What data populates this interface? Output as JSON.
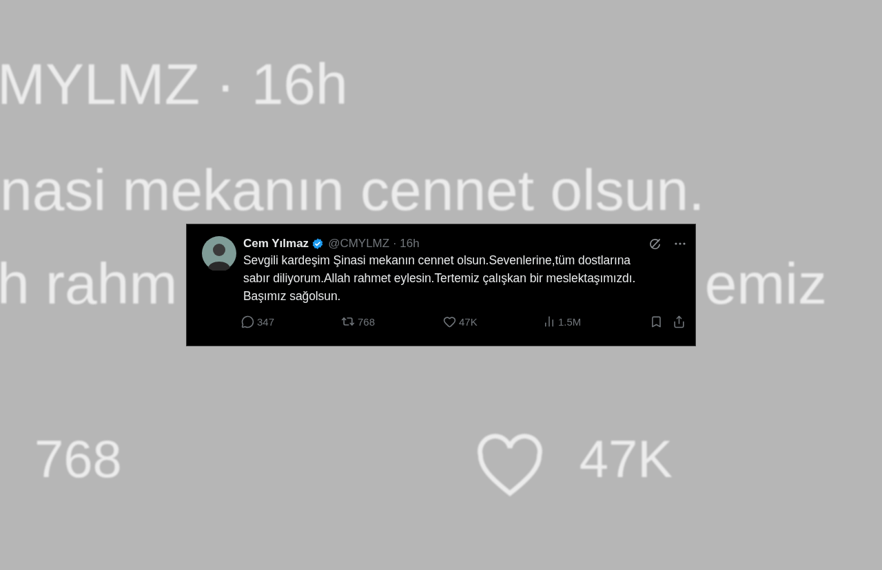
{
  "background": {
    "handle_line": "MYLMZ · 16h",
    "line_1": "nasi mekanın cennet olsun.",
    "line_2_left": "h rahm",
    "line_2_right": "emiz",
    "retweets": "768",
    "likes": "47K"
  },
  "tweet": {
    "name": "Cem Yılmaz",
    "verified": true,
    "meta": "@CMYLMZ · 16h",
    "text": "Sevgili kardeşim Şinasi mekanın cennet olsun.Sevenlerine,tüm dostlarına\nsabır diliyorum.Allah rahmet eylesin.Tertemiz çalışkan bir meslektaşımızdı.\nBaşımız sağolsun.",
    "actions": [
      {
        "kind": "reply",
        "count": "347"
      },
      {
        "kind": "retweet",
        "count": "768"
      },
      {
        "kind": "like",
        "count": "47K"
      },
      {
        "kind": "views",
        "count": "1.5M"
      },
      {
        "kind": "bookmark"
      },
      {
        "kind": "share"
      }
    ]
  }
}
